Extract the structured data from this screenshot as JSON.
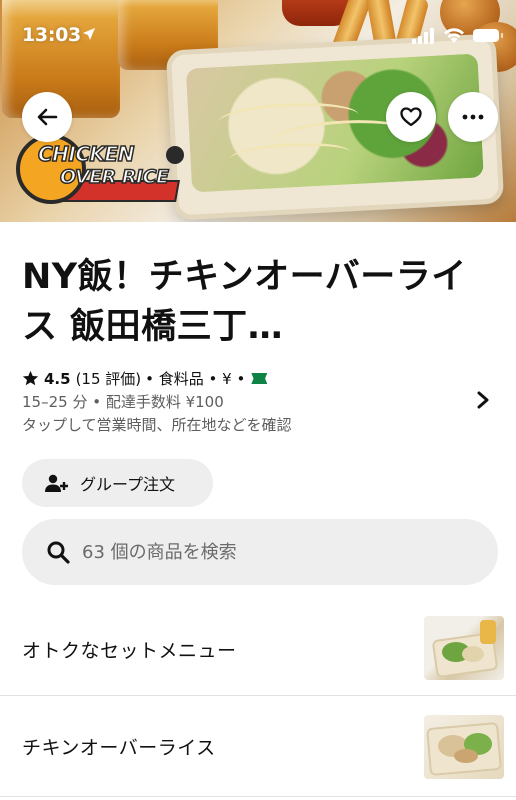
{
  "status_bar": {
    "time": "13:03"
  },
  "hero": {
    "logo_line1": "CHICKEN",
    "logo_line2": "OVER RICE"
  },
  "store": {
    "title": "NY飯！チキンオーバーライス 飯田橋三丁…",
    "rating": "4.5",
    "rating_count": "(15 評価)",
    "meta_suffix": "• 食料品 • ¥ •",
    "delivery": "15–25 分 • 配達手数料 ¥100",
    "info_hint": "タップして営業時間、所在地などを確認"
  },
  "group_order": {
    "label": "グループ注文"
  },
  "search": {
    "placeholder": "63 個の商品を検索"
  },
  "categories": [
    {
      "label": "オトクなセットメニュー"
    },
    {
      "label": "チキンオーバーライス"
    }
  ],
  "icons": {
    "back": "arrow-left-icon",
    "favorite": "heart-icon",
    "more": "more-horizontal-icon",
    "star": "star-icon",
    "group": "add-user-icon",
    "search": "search-icon",
    "chevron": "chevron-right-icon"
  },
  "colors": {
    "badge_green": "#0e8345",
    "pill_bg": "#eeeeee",
    "secondary_text": "#5e5e5e"
  }
}
